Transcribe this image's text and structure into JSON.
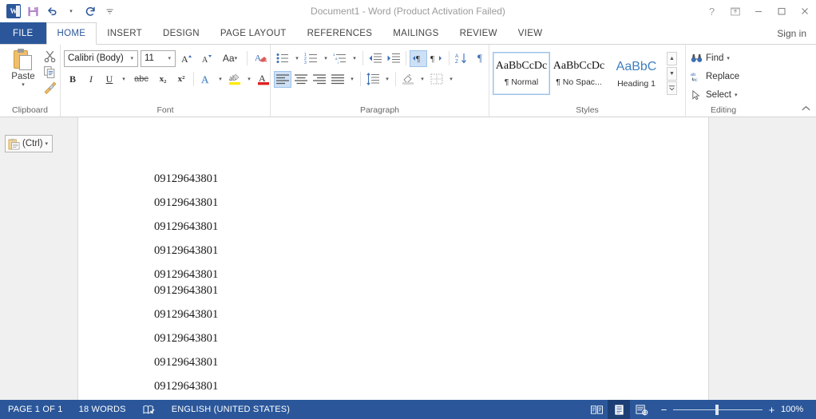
{
  "titlebar": {
    "app_icon": "word-logo-icon",
    "app_letter": "W",
    "quick_access": [
      {
        "name": "save-icon",
        "label": "Save"
      },
      {
        "name": "undo-icon",
        "label": "Undo"
      },
      {
        "name": "redo-icon",
        "label": "Redo"
      },
      {
        "name": "customize-quick-access-toolbar-icon",
        "label": "Customize Quick Access Toolbar"
      }
    ],
    "title": "Document1 - Word (Product Activation Failed)",
    "help_label": "?",
    "ribbon_display_label": "Ribbon Display Options",
    "minimize_label": "─",
    "maximize_label": "☐",
    "close_label": "✕"
  },
  "tabs": {
    "file": "FILE",
    "items": [
      "HOME",
      "INSERT",
      "DESIGN",
      "PAGE LAYOUT",
      "REFERENCES",
      "MAILINGS",
      "REVIEW",
      "VIEW"
    ],
    "active": "HOME",
    "sign_in": "Sign in"
  },
  "ribbon": {
    "clipboard": {
      "label": "Clipboard",
      "paste_label": "Paste",
      "paste_caret": "▾",
      "cut_label": "Cut",
      "copy_label": "Copy",
      "format_painter_label": "Format Painter",
      "dialog_launcher": "❱"
    },
    "font": {
      "label": "Font",
      "font_name": "Calibri (Body)",
      "font_size": "11",
      "grow_font": "A",
      "shrink_font": "A",
      "change_case": "Aa",
      "clear_formatting": "Clear All Formatting",
      "bold": "B",
      "italic": "I",
      "underline": "U",
      "strikethrough": "abc",
      "subscript": "x₂",
      "superscript": "x²",
      "text_effects": "A",
      "highlight": "ab",
      "font_color": "A",
      "dialog_launcher": "❱"
    },
    "paragraph": {
      "label": "Paragraph",
      "bullets": "Bullets",
      "numbering": "Numbering",
      "multilevel": "Multilevel List",
      "decrease_indent": "Decrease Indent",
      "increase_indent": "Increase Indent",
      "ltr": "Left-to-Right Text Direction",
      "rtl": "Right-to-Left Text Direction",
      "sort": "Sort",
      "show_marks": "¶",
      "align_left": "Align Left",
      "align_center": "Center",
      "align_right": "Align Right",
      "justify": "Justify",
      "line_spacing": "Line and Paragraph Spacing",
      "shading": "Shading",
      "borders": "Borders",
      "dialog_launcher": "❱"
    },
    "styles": {
      "label": "Styles",
      "items": [
        {
          "preview": "AaBbCcDc",
          "name": "¶ Normal",
          "selected": true
        },
        {
          "preview": "AaBbCcDc",
          "name": "¶ No Spac...",
          "selected": false
        },
        {
          "preview": "AaBbC\u0001",
          "name": "Heading 1",
          "selected": false
        }
      ],
      "nav_up": "▲",
      "nav_down": "▼",
      "nav_more": "▾",
      "dialog_launcher": "❱"
    },
    "editing": {
      "label": "Editing",
      "find": "Find",
      "find_caret": "▾",
      "replace": "Replace",
      "select": "Select",
      "select_caret": "▾"
    },
    "collapse_ribbon": "⌃"
  },
  "document": {
    "paste_options": {
      "label": "(Ctrl)",
      "caret": "▾",
      "icon": "paste-options-clipboard-icon"
    },
    "lines": [
      {
        "text": "09129643801",
        "tight": false
      },
      {
        "text": "09129643801",
        "tight": false
      },
      {
        "text": "09129643801",
        "tight": false
      },
      {
        "text": "09129643801",
        "tight": false
      },
      {
        "text": "09129643801",
        "tight": true
      },
      {
        "text": "09129643801",
        "tight": false
      },
      {
        "text": "09129643801",
        "tight": false
      },
      {
        "text": "09129643801",
        "tight": false
      },
      {
        "text": "09129643801",
        "tight": false
      },
      {
        "text": "09129643801",
        "tight": false
      }
    ]
  },
  "status": {
    "page": "PAGE 1 OF 1",
    "words": "18 WORDS",
    "proofing_icon": "proofing-errors-icon",
    "language": "ENGLISH (UNITED STATES)",
    "views": [
      {
        "name": "read-mode-icon",
        "label": "Read Mode",
        "active": false
      },
      {
        "name": "print-layout-icon",
        "label": "Print Layout",
        "active": true
      },
      {
        "name": "web-layout-icon",
        "label": "Web Layout",
        "active": false
      }
    ],
    "zoom_out": "−",
    "zoom_in": "+",
    "zoom_value": "100%"
  },
  "colors": {
    "accent": "#2b579a",
    "status_bar": "#2b579a",
    "tab_active_text": "#2b579a",
    "heading1": "#3f7fbf",
    "doc_background": "#f0f0f0"
  }
}
